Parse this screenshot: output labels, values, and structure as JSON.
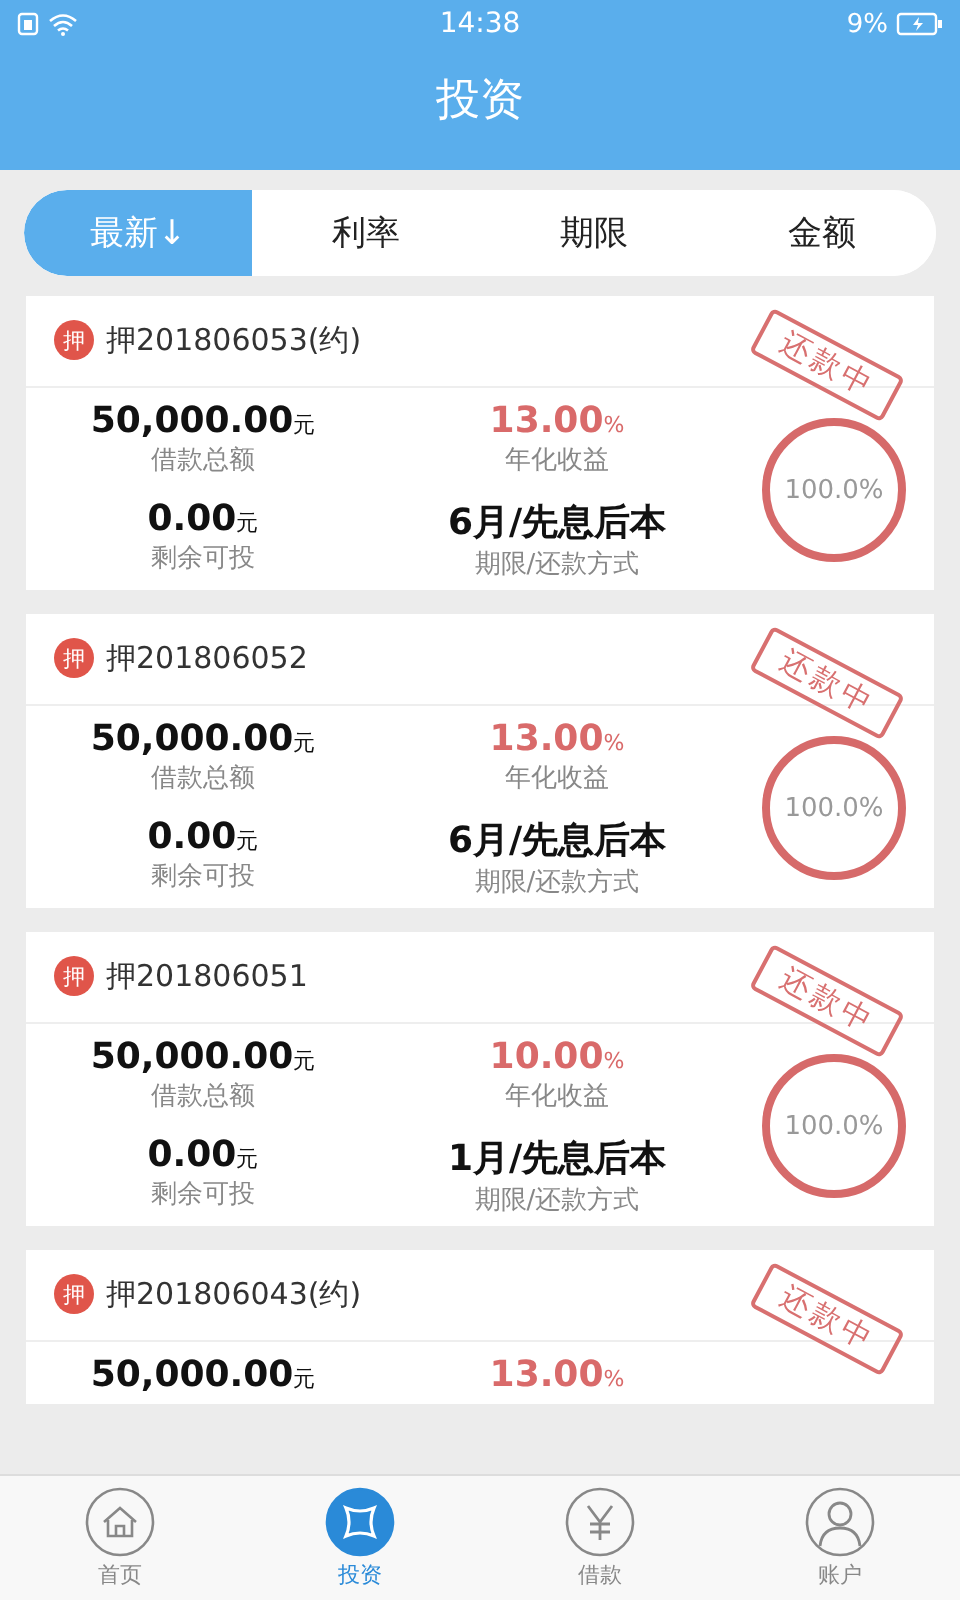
{
  "status_bar": {
    "time": "14:38",
    "battery": "9%"
  },
  "header": {
    "title": "投资"
  },
  "tabs": [
    {
      "label": "最新↓",
      "selected": true
    },
    {
      "label": "利率",
      "selected": false
    },
    {
      "label": "期限",
      "selected": false
    },
    {
      "label": "金额",
      "selected": false
    }
  ],
  "loans": [
    {
      "badge": "押",
      "title": "押201806053(约)",
      "stamp": "还款中",
      "amount": "50,000.00",
      "amount_unit": "元",
      "amount_label": "借款总额",
      "rate": "13.00",
      "rate_unit": "%",
      "rate_label": "年化收益",
      "remaining": "0.00",
      "remaining_unit": "元",
      "remaining_label": "剩余可投",
      "term": "6月/先息后本",
      "term_label": "期限/还款方式",
      "progress": "100.0%"
    },
    {
      "badge": "押",
      "title": "押201806052",
      "stamp": "还款中",
      "amount": "50,000.00",
      "amount_unit": "元",
      "amount_label": "借款总额",
      "rate": "13.00",
      "rate_unit": "%",
      "rate_label": "年化收益",
      "remaining": "0.00",
      "remaining_unit": "元",
      "remaining_label": "剩余可投",
      "term": "6月/先息后本",
      "term_label": "期限/还款方式",
      "progress": "100.0%"
    },
    {
      "badge": "押",
      "title": "押201806051",
      "stamp": "还款中",
      "amount": "50,000.00",
      "amount_unit": "元",
      "amount_label": "借款总额",
      "rate": "10.00",
      "rate_unit": "%",
      "rate_label": "年化收益",
      "remaining": "0.00",
      "remaining_unit": "元",
      "remaining_label": "剩余可投",
      "term": "1月/先息后本",
      "term_label": "期限/还款方式",
      "progress": "100.0%"
    },
    {
      "badge": "押",
      "title": "押201806043(约)",
      "stamp": "还款中",
      "amount": "50,000.00",
      "amount_unit": "元",
      "rate": "13.00",
      "rate_unit": "%"
    }
  ],
  "bottom_nav": [
    {
      "kind": "home",
      "label": "首页",
      "selected": false
    },
    {
      "kind": "invest",
      "label": "投资",
      "selected": true
    },
    {
      "kind": "loan",
      "label": "借款",
      "selected": false
    },
    {
      "kind": "account",
      "label": "账户",
      "selected": false
    }
  ]
}
